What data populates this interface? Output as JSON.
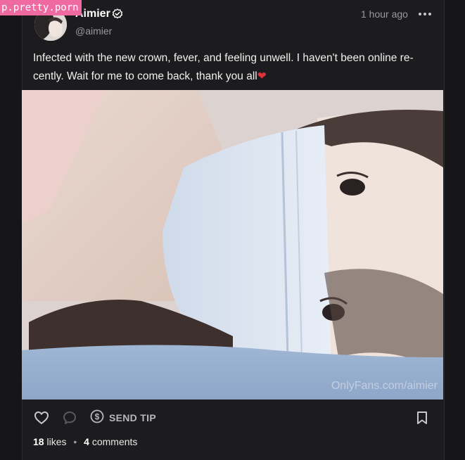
{
  "overlay": {
    "watermark_text": "p.pretty.porn"
  },
  "post": {
    "author_name": "Aimier",
    "author_handle": "@aimier",
    "timestamp": "1 hour ago",
    "text": "Infected with the new crown, fever, and feeling unwell. I haven't been online re- cently. Wait for me to come back, thank you all",
    "text_emoji": "❤",
    "media_watermark": "OnlyFans.com/aimier"
  },
  "actions": {
    "like_icon": "heart-outline-icon",
    "comment_icon": "comment-bubble-icon",
    "tip_icon": "dollar-circle-icon",
    "tip_label": "SEND TIP",
    "bookmark_icon": "bookmark-icon",
    "more_icon": "more-horizontal-icon",
    "verified_icon": "verified-badge-icon"
  },
  "stats": {
    "likes_count": "18",
    "likes_label": "likes",
    "comments_count": "4",
    "comments_label": "comments"
  },
  "colors": {
    "background": "#161618",
    "card": "#1c1c1e",
    "watermark_bg": "#f06aa2",
    "muted_text": "#9a9a9e",
    "heart": "#e0303a"
  }
}
